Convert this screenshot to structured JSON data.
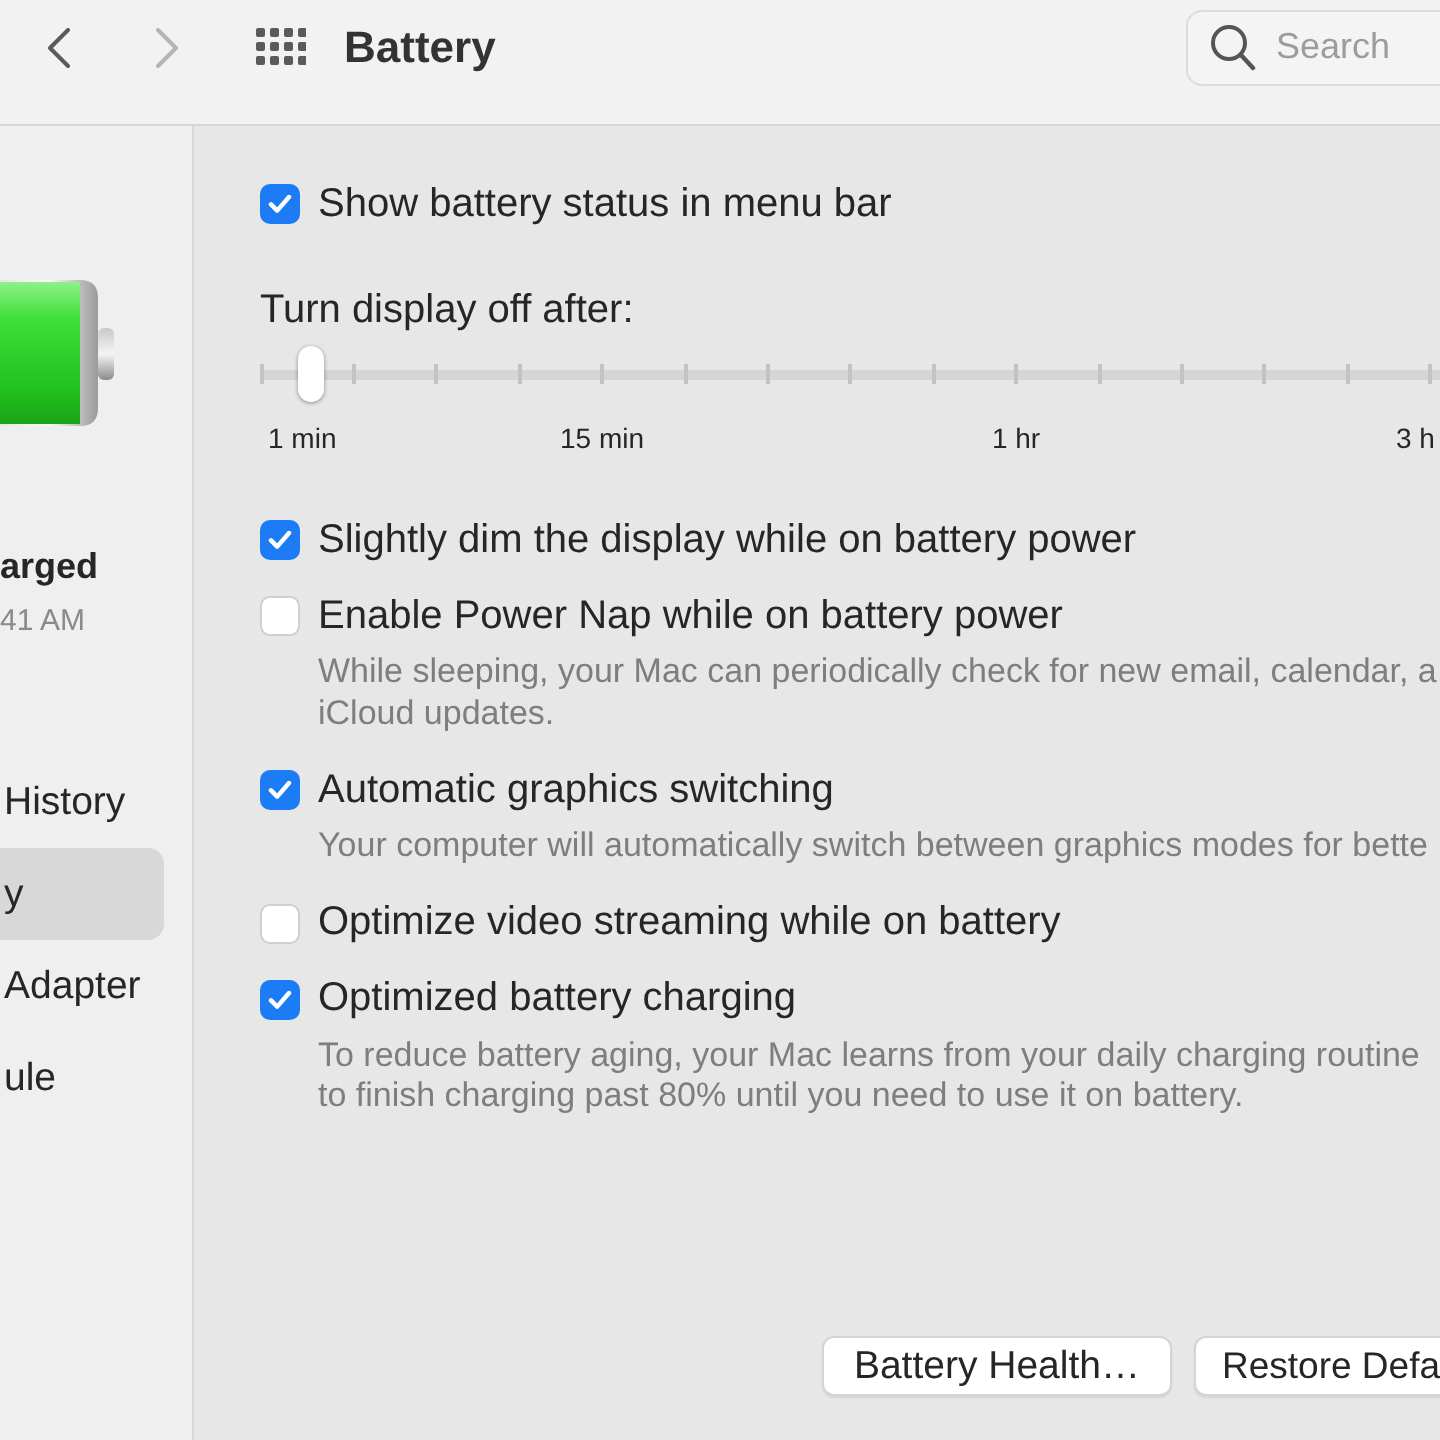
{
  "toolbar": {
    "nav": [
      {
        "kind": "back",
        "disabled": false
      },
      {
        "kind": "forward",
        "disabled": true
      }
    ],
    "title": "Battery",
    "search": {
      "placeholder": "Search"
    }
  },
  "sidebar": {
    "status": {
      "title": "arged",
      "detail": "41 AM"
    },
    "items": [
      {
        "label": "History",
        "selected": false
      },
      {
        "label": "y",
        "selected": true
      },
      {
        "label": "Adapter",
        "selected": false
      },
      {
        "label": "ule",
        "selected": false
      }
    ]
  },
  "settings": [
    {
      "kind": "checkbox",
      "label": "Show battery status in menu bar",
      "checked": true
    },
    {
      "kind": "slider",
      "label": "Turn display off after:",
      "level": 0.044,
      "marks": [
        "1 min",
        "15 min",
        "1 hr",
        "3 h"
      ]
    },
    {
      "kind": "checkbox",
      "label": "Slightly dim the display while on battery power",
      "checked": true
    },
    {
      "kind": "checkbox",
      "label": "Enable Power Nap while on battery power",
      "checked": false,
      "description": [
        "While sleeping, your Mac can periodically check for new email, calendar, a",
        "iCloud updates."
      ]
    },
    {
      "kind": "checkbox",
      "label": "Automatic graphics switching",
      "checked": true,
      "description": [
        "Your computer will automatically switch between graphics modes for bette"
      ]
    },
    {
      "kind": "checkbox",
      "label": "Optimize video streaming while on battery",
      "checked": false
    },
    {
      "kind": "checkbox",
      "label": "Optimized battery charging",
      "checked": true,
      "description": [
        "To reduce battery aging, your Mac learns from your daily charging routine",
        "to finish charging past 80% until you need to use it on battery."
      ]
    }
  ],
  "buttons": [
    {
      "label": "Battery Health…"
    },
    {
      "label": "Restore Defa"
    }
  ]
}
